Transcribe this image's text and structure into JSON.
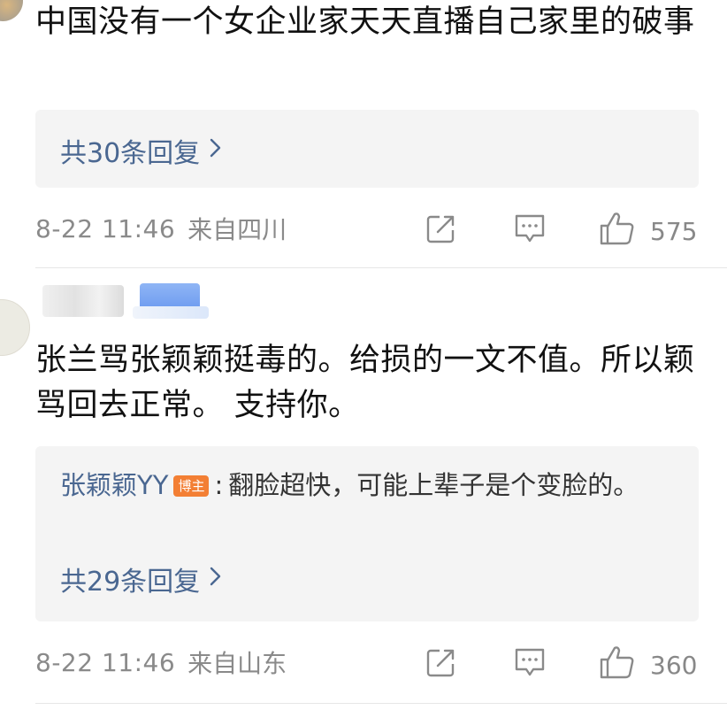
{
  "comments": [
    {
      "text": "中国没有一个女企业家天天直播自己家里的破事",
      "reply_count_label": "共30条回复",
      "timestamp": "8-22 11:46",
      "location": "来自四川",
      "like_count": "575"
    },
    {
      "text": "张兰骂张颖颖挺毒的。给损的一文不值。所以颖骂回去正常。 支持你。",
      "sub_reply": {
        "author": "张颖颖YY",
        "badge": "博主",
        "separator": ":",
        "text": "翻脸超快，可能上辈子是个变脸的。"
      },
      "reply_count_label": "共29条回复",
      "timestamp": "8-22 11:46",
      "location": "来自山东",
      "like_count": "360"
    }
  ],
  "icons": {
    "share": "share-icon",
    "comment": "comment-icon",
    "like": "thumbs-up-icon",
    "chevron": "chevron-right-icon"
  },
  "colors": {
    "link_blue": "#4a6791",
    "badge_orange": "#f37f34",
    "meta_gray": "#8a8a8a",
    "reply_bg": "#f4f4f4"
  }
}
